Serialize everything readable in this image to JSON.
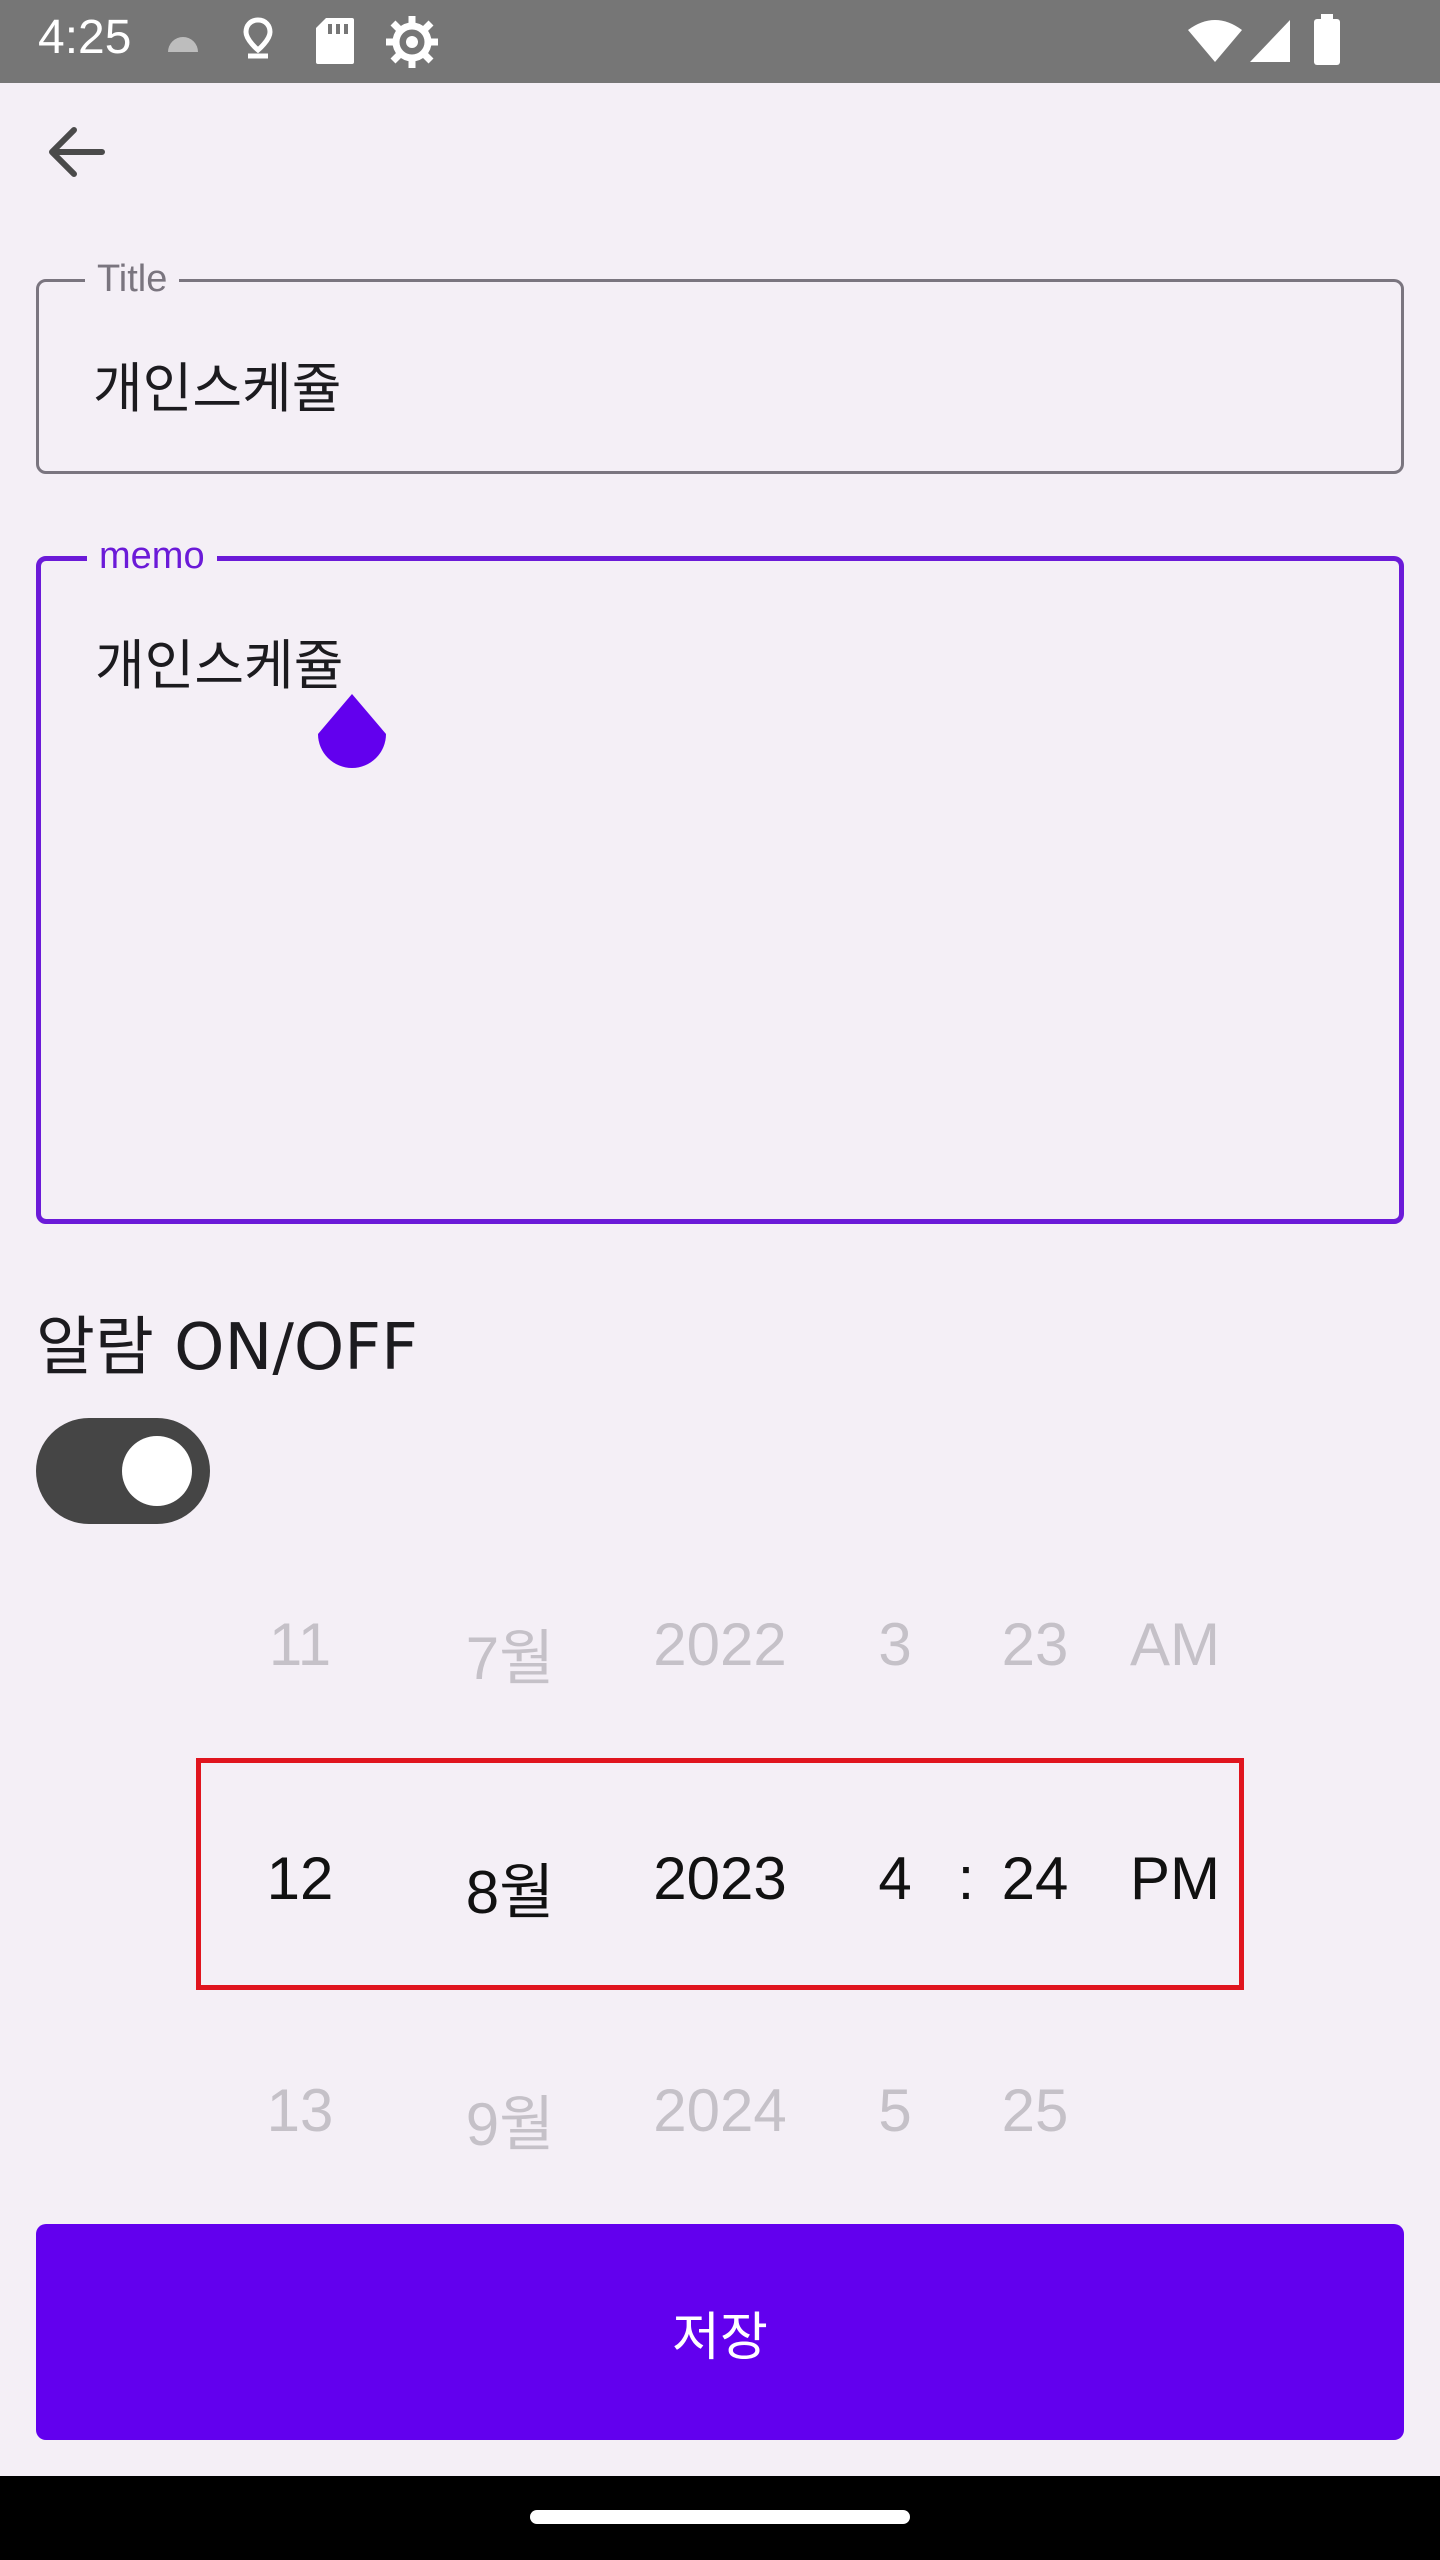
{
  "status_bar": {
    "time": "4:25",
    "icons_left": [
      "android-icon",
      "location-icon",
      "sd-card-icon",
      "settings-icon"
    ],
    "icons_right": [
      "wifi-icon",
      "signal-icon",
      "battery-icon"
    ]
  },
  "toolbar": {
    "back_icon": "arrow-left-icon"
  },
  "title_field": {
    "label": "Title",
    "value": "개인스케쥴"
  },
  "memo_field": {
    "label": "memo",
    "value": "개인스케쥴"
  },
  "alarm": {
    "label": "알람 ON/OFF",
    "enabled": true
  },
  "picker": {
    "above": {
      "day": "11",
      "month": "7월",
      "year": "2022",
      "hour": "3",
      "minute": "23",
      "ampm": "AM"
    },
    "selected": {
      "day": "12",
      "month": "8월",
      "year": "2023",
      "hour": "4",
      "separator": ":",
      "minute": "24",
      "ampm": "PM"
    },
    "below": {
      "day": "13",
      "month": "9월",
      "year": "2024",
      "hour": "5",
      "minute": "25"
    }
  },
  "save_button": {
    "label": "저장"
  },
  "colors": {
    "accent": "#6200ee",
    "focus_border": "#6b1ad8",
    "selection_box": "#e0141e",
    "background": "#f4eff6"
  }
}
